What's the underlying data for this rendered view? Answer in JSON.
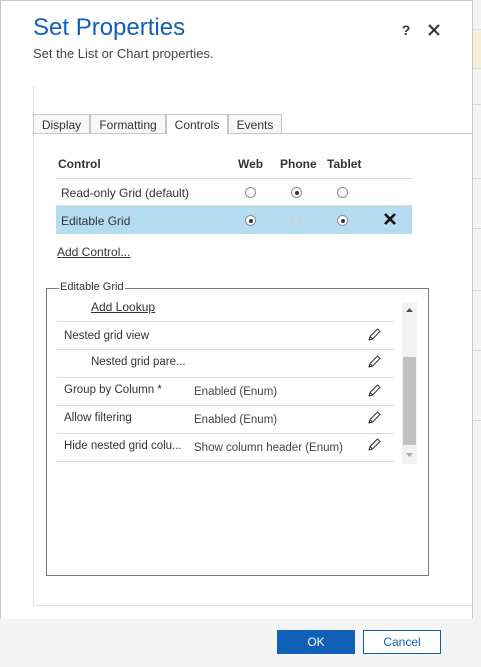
{
  "dialog": {
    "title": "Set Properties",
    "subtitle": "Set the List or Chart properties.",
    "help_label": "?"
  },
  "tabs": [
    {
      "label": "Display",
      "active": false
    },
    {
      "label": "Formatting",
      "active": false
    },
    {
      "label": "Controls",
      "active": true
    },
    {
      "label": "Events",
      "active": false
    }
  ],
  "controls_table": {
    "headers": [
      "Control",
      "Web",
      "Phone",
      "Tablet"
    ],
    "rows": [
      {
        "label": "Read-only Grid (default)",
        "web": "unchecked",
        "phone": "checked",
        "tablet": "unchecked",
        "selected": false
      },
      {
        "label": "Editable Grid",
        "web": "checked",
        "phone": "disabled",
        "tablet": "checked",
        "selected": true
      }
    ],
    "add_control_label": "Add Control..."
  },
  "editable_grid": {
    "legend": "Editable Grid",
    "add_lookup_label": "Add Lookup",
    "properties": [
      {
        "label": "Nested grid view",
        "value": ""
      },
      {
        "label": "Nested grid pare...",
        "value": ""
      },
      {
        "label": "Group by Column *",
        "value": "Enabled (Enum)"
      },
      {
        "label": "Allow filtering",
        "value": "Enabled (Enum)"
      },
      {
        "label": "Hide nested grid colu...",
        "value": "Show column header (Enum)"
      }
    ]
  },
  "footer": {
    "ok_label": "OK",
    "cancel_label": "Cancel"
  },
  "colors": {
    "accent": "#1160b7",
    "selected_row": "#b6dcf2"
  },
  "icons": {
    "close": "close-icon",
    "remove": "remove-control-icon",
    "edit": "pencil-icon",
    "scroll_up": "scroll-up-arrow-icon",
    "scroll_down": "scroll-down-arrow-icon"
  }
}
